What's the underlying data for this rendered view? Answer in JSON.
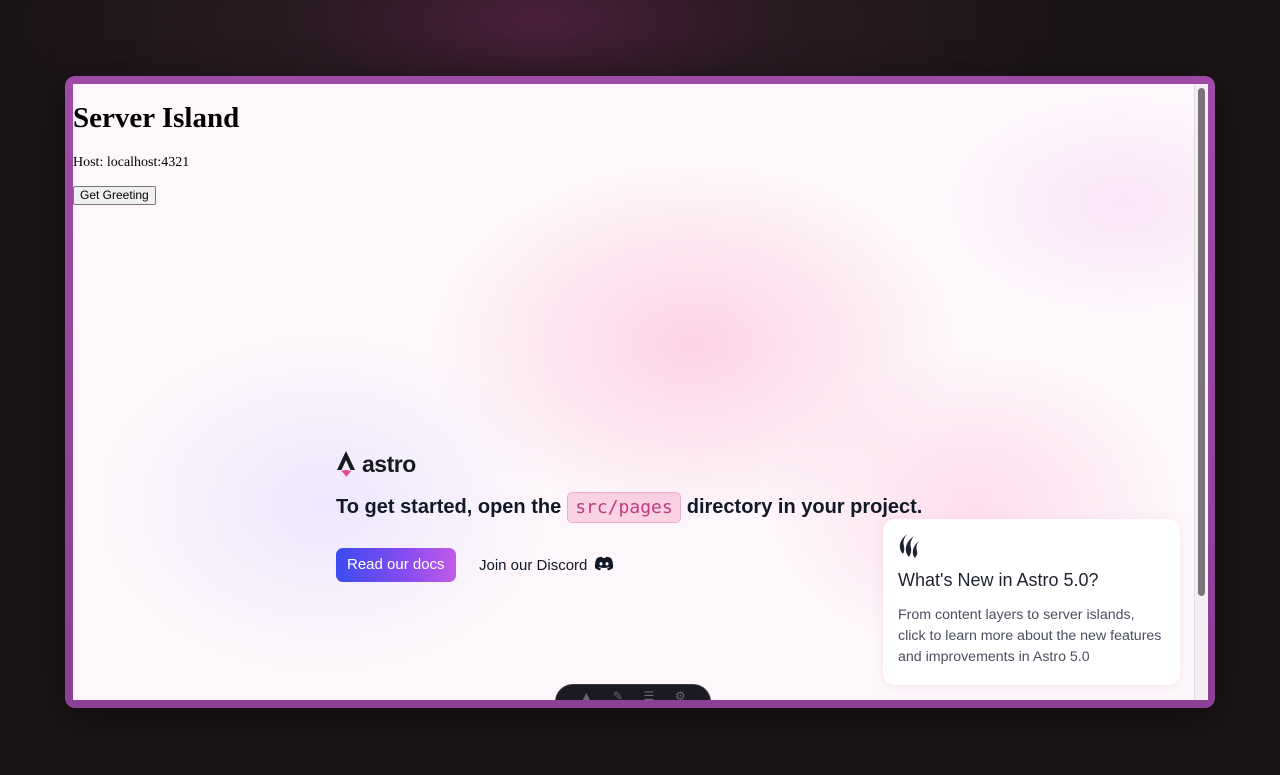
{
  "page": {
    "heading": "Server Island",
    "host_text": "Host: localhost:4321",
    "greeting_button": "Get Greeting"
  },
  "welcome": {
    "logo_text": "astro",
    "headline_before": "To get started, open the",
    "headline_code": "src/pages",
    "headline_after": "directory in your project.",
    "docs_button": "Read our docs",
    "discord_link": "Join our Discord"
  },
  "news_card": {
    "title": "What's New in Astro 5.0?",
    "body": "From content layers to server islands, click to learn more about the new features and improvements in Astro 5.0"
  },
  "colors": {
    "frame": "#9a47a3",
    "accent_start": "#3b4cf0",
    "accent_end": "#c15ae8",
    "code_text": "#c03a7e"
  },
  "icons": {
    "logo": "astro-logo-icon",
    "discord": "discord-icon",
    "news": "flame-icon"
  }
}
